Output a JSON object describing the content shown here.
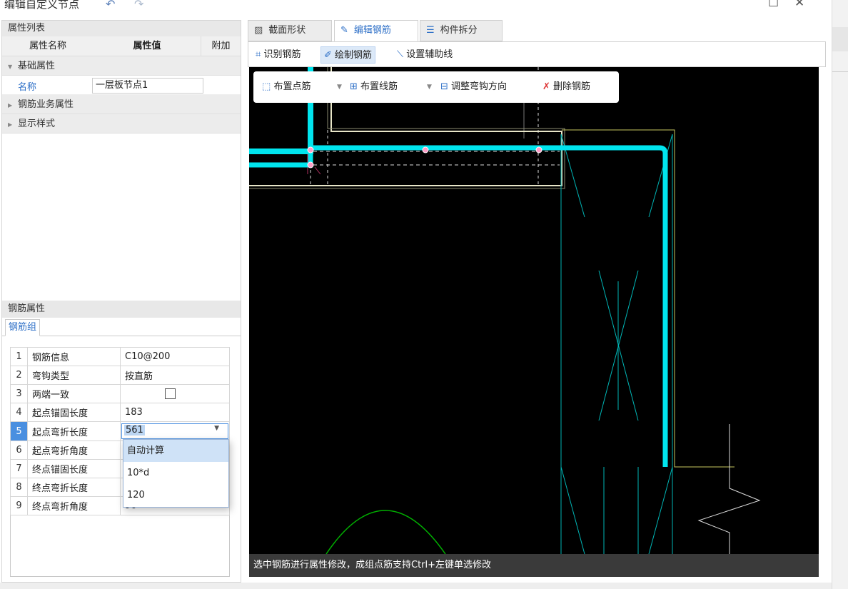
{
  "window": {
    "title": "编辑自定义节点",
    "undo_icon": "↶",
    "redo_icon": "↷",
    "maximize_icon": "☐",
    "close_icon": "✕"
  },
  "props": {
    "header": "属性列表",
    "columns": [
      "属性名称",
      "属性值",
      "附加"
    ],
    "groups": {
      "basic": "基础属性",
      "rebar_business": "钢筋业务属性",
      "display_style": "显示样式"
    },
    "name_label": "名称",
    "name_value": "一层板节点1"
  },
  "rebar": {
    "header": "钢筋属性",
    "tab": "钢筋组",
    "rows": [
      {
        "num": "1",
        "name": "钢筋信息",
        "value": "C10@200"
      },
      {
        "num": "2",
        "name": "弯钩类型",
        "value": "按直筋"
      },
      {
        "num": "3",
        "name": "两端一致",
        "value": ""
      },
      {
        "num": "4",
        "name": "起点锚固长度",
        "value": "183"
      },
      {
        "num": "5",
        "name": "起点弯折长度",
        "value": "561"
      },
      {
        "num": "6",
        "name": "起点弯折角度",
        "value": ""
      },
      {
        "num": "7",
        "name": "终点锚固长度",
        "value": ""
      },
      {
        "num": "8",
        "name": "终点弯折长度",
        "value": ""
      },
      {
        "num": "9",
        "name": "终点弯折角度",
        "value": "90"
      }
    ],
    "dropdown_options": [
      "自动计算",
      "10*d",
      "120"
    ]
  },
  "tabs": [
    "截面形状",
    "编辑钢筋",
    "构件拆分"
  ],
  "toolbar": {
    "recognize": "识别钢筋",
    "draw": "绘制钢筋",
    "aux_line": "设置辅助线"
  },
  "floatbar": {
    "point_rebar": "布置点筋",
    "line_rebar": "布置线筋",
    "hook_dir": "调整弯钩方向",
    "delete": "删除钢筋"
  },
  "status": "选中钢筋进行属性修改，成组点筋支持Ctrl+左键单选修改",
  "colors": {
    "rebar": "#00e5ee",
    "accent": "#2d6fc7",
    "selected_row": "#4a8fe0",
    "canvas": "#000000"
  }
}
